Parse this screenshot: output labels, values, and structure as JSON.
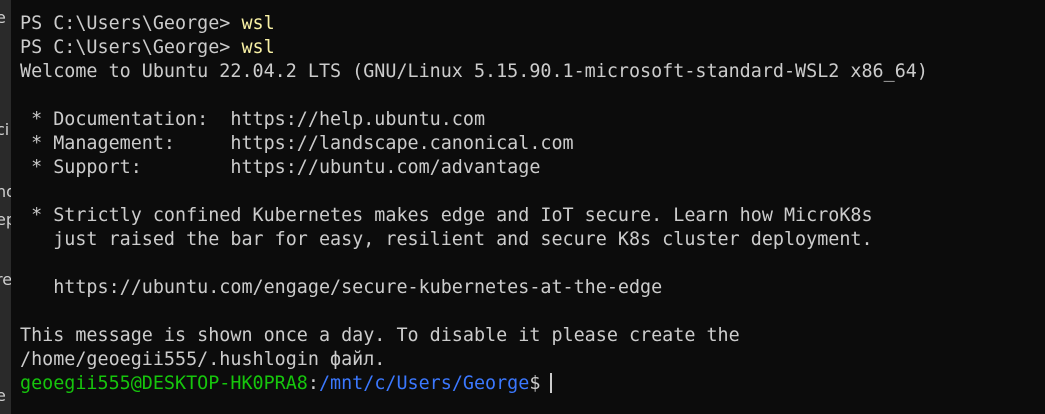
{
  "side_fragments": [
    "e",
    "ci",
    "nd",
    "ep",
    "re",
    "e"
  ],
  "terminal": {
    "lines": [
      {
        "prompt": "PS C:\\Users\\George> ",
        "command": "wsl"
      },
      {
        "prompt": "PS C:\\Users\\George> ",
        "command": "wsl"
      },
      {
        "text": "Welcome to Ubuntu 22.04.2 LTS (GNU/Linux 5.15.90.1-microsoft-standard-WSL2 x86_64)"
      },
      {
        "text": ""
      },
      {
        "text": " * Documentation:  https://help.ubuntu.com"
      },
      {
        "text": " * Management:     https://landscape.canonical.com"
      },
      {
        "text": " * Support:        https://ubuntu.com/advantage"
      },
      {
        "text": ""
      },
      {
        "text": " * Strictly confined Kubernetes makes edge and IoT secure. Learn how MicroK8s"
      },
      {
        "text": "   just raised the bar for easy, resilient and secure K8s cluster deployment."
      },
      {
        "text": ""
      },
      {
        "text": "   https://ubuntu.com/engage/secure-kubernetes-at-the-edge"
      },
      {
        "text": ""
      },
      {
        "text": "This message is shown once a day. To disable it please create the"
      },
      {
        "text": "/home/geoegii555/.hushlogin файл."
      }
    ],
    "bash_prompt": {
      "user_host": "geoegii555@DESKTOP-HK0PRA8",
      "separator": ":",
      "path": "/mnt/c/Users/George",
      "symbol": "$"
    }
  }
}
